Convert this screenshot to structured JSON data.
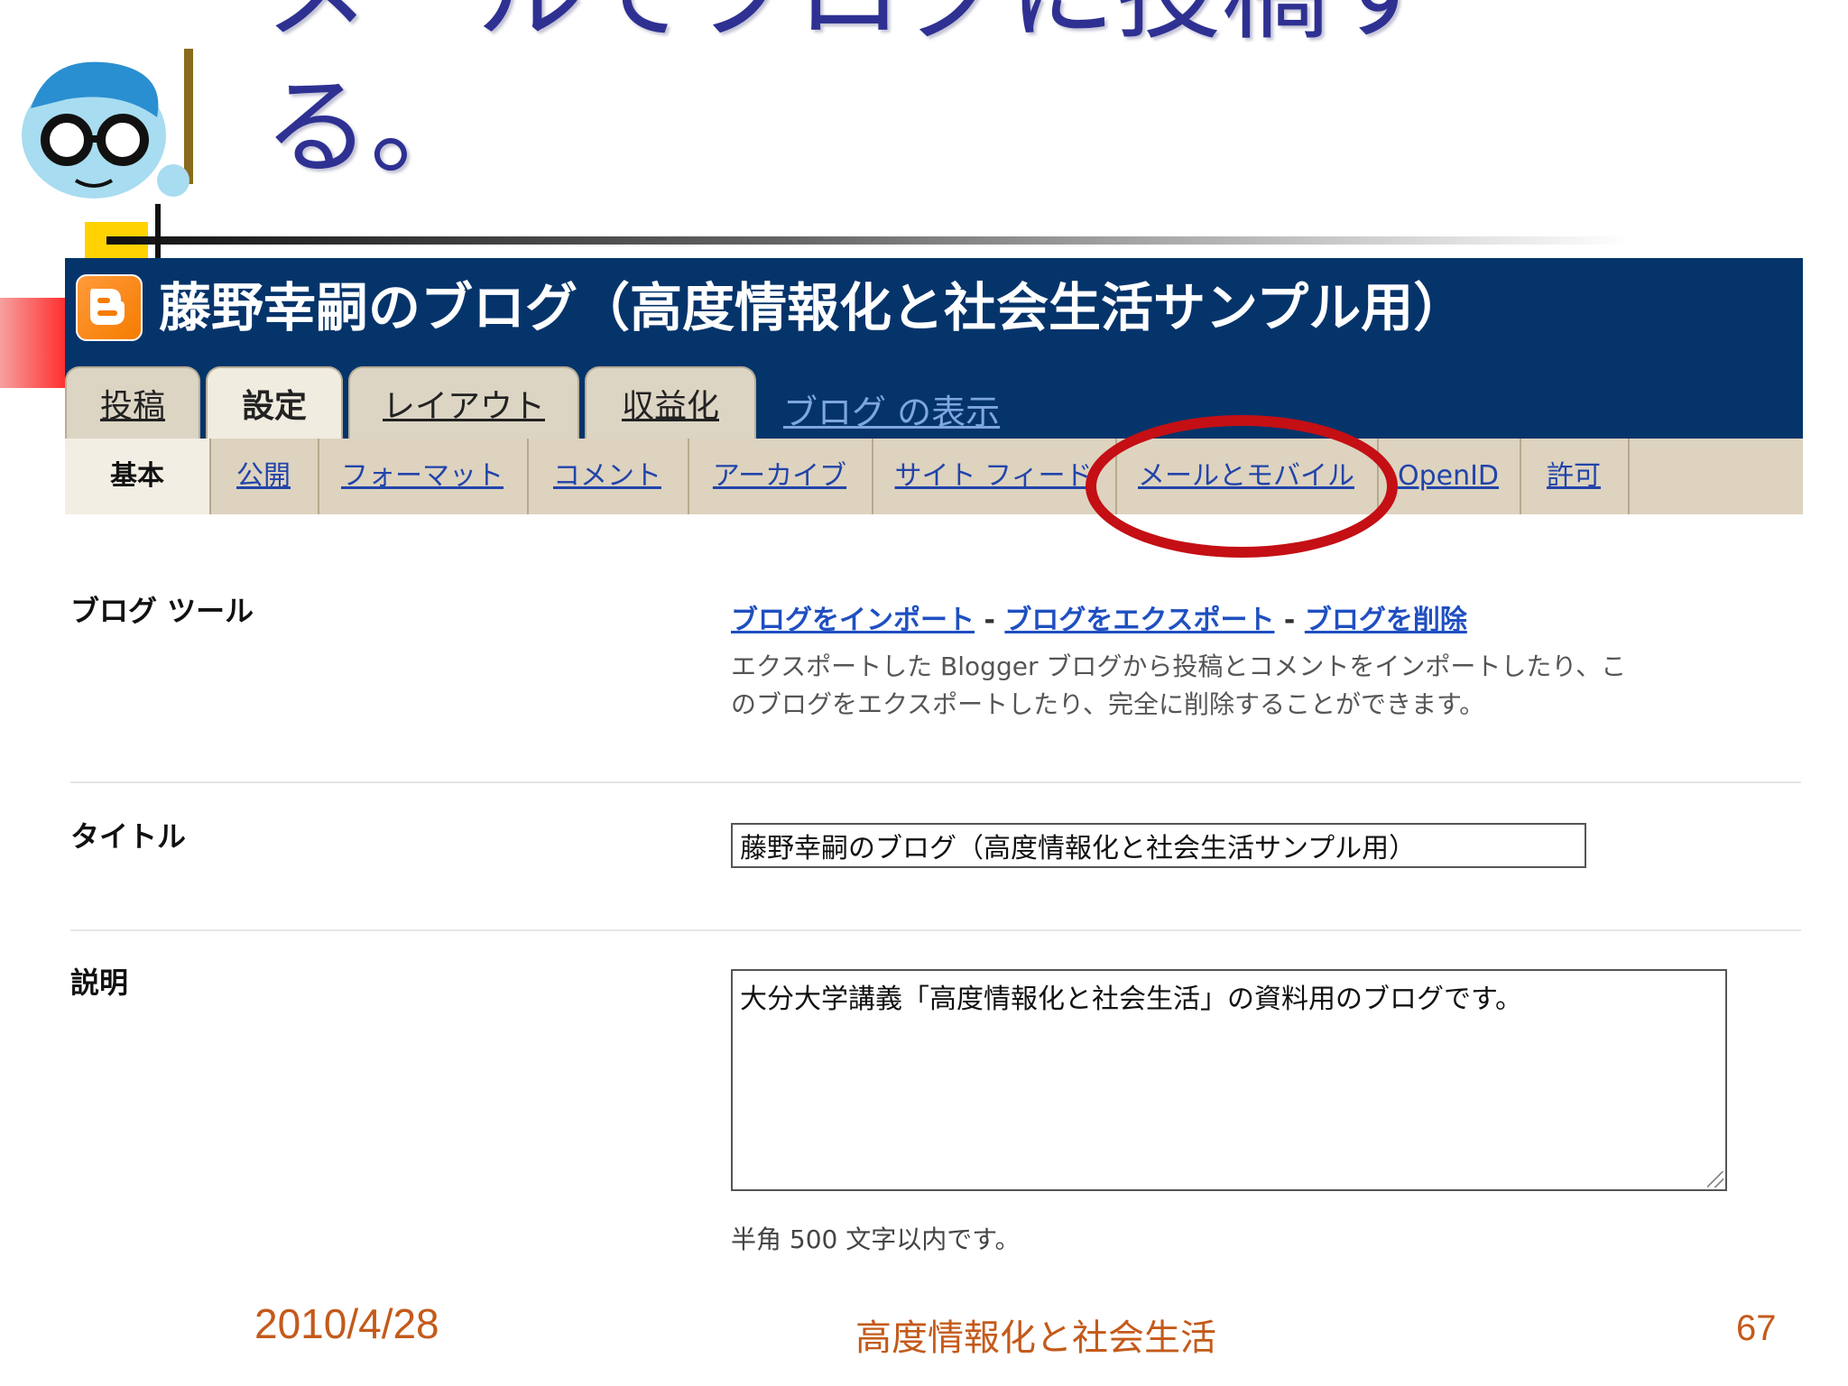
{
  "slide": {
    "title_line1": "メールでブログに投稿す",
    "title_line2": "る。"
  },
  "blog": {
    "title": "藤野幸嗣のブログ（高度情報化と社会生活サンプル用）",
    "tabs": [
      {
        "label": "投稿",
        "active": false
      },
      {
        "label": "設定",
        "active": true
      },
      {
        "label": "レイアウト",
        "active": false
      },
      {
        "label": "収益化",
        "active": false
      }
    ],
    "view_blog": "ブログ の表示"
  },
  "subnav": {
    "items": [
      {
        "label": "基本",
        "active": true
      },
      {
        "label": "公開",
        "active": false
      },
      {
        "label": "フォーマット",
        "active": false
      },
      {
        "label": "コメント",
        "active": false
      },
      {
        "label": "アーカイブ",
        "active": false
      },
      {
        "label": "サイト フィード",
        "active": false
      },
      {
        "label": "メールとモバイル",
        "active": false,
        "highlighted": true
      },
      {
        "label": "OpenID",
        "active": false
      },
      {
        "label": "許可",
        "active": false
      }
    ]
  },
  "form": {
    "tools_label": "ブログ ツール",
    "tools_links": [
      "ブログをインポート",
      "ブログをエクスポート",
      "ブログを削除"
    ],
    "link_separator": "-",
    "tools_desc_1": "エクスポートした Blogger ブログから投稿とコメントをインポートしたり、こ",
    "tools_desc_2": "のブログをエクスポートしたり、完全に削除することができます。",
    "title_label": "タイトル",
    "title_value": "藤野幸嗣のブログ（高度情報化と社会生活サンプル用）",
    "desc_label": "説明",
    "desc_value": "大分大学講義「高度情報化と社会生活」の資料用のブログです。",
    "desc_hint": "半角 500 文字以内です。"
  },
  "footer": {
    "date": "2010/4/28",
    "center": "高度情報化と社会生活",
    "page": "67"
  },
  "colors": {
    "title": "#2e3192",
    "header_bg": "#05346b",
    "highlight_ring": "#c40f14",
    "link": "#1f4fc1",
    "footer": "#c45a1a"
  },
  "icons": [
    "teacher-mascot-icon",
    "blogger-logo-icon",
    "resize-grip-icon"
  ]
}
